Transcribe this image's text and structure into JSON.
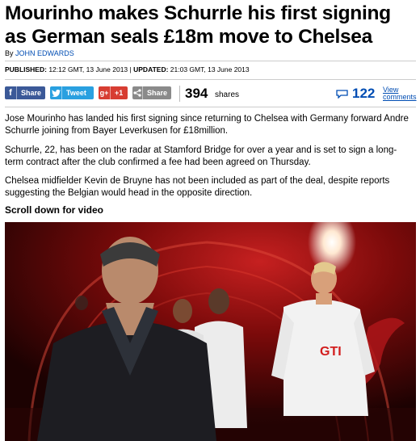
{
  "article": {
    "headline": "Mourinho makes Schurrle his first signing as German seals £18m move to Chelsea",
    "byline_prefix": "By",
    "author": "JOHN EDWARDS",
    "published_label": "PUBLISHED:",
    "published_value": "12:12 GMT, 13 June 2013",
    "separator": "|",
    "updated_label": "UPDATED:",
    "updated_value": "21:03 GMT, 13 June 2013",
    "paragraphs": [
      "Jose Mourinho has landed his first signing since returning to Chelsea with Germany forward Andre Schurrle joining from Bayer Leverkusen for £18million.",
      "Schurrle, 22, has been on the radar at Stamford Bridge for over a year and is set to sign a long-term contract after the club confirmed a fee had been agreed on Thursday.",
      "Chelsea midfielder Kevin de Bruyne has not been included as part of the deal, despite reports suggesting the Belgian would head in the opposite direction."
    ],
    "video_heading": "Scroll down for video",
    "shirt_sponsor": "GTI"
  },
  "share_bar": {
    "facebook": {
      "icon": "f",
      "label": "Share"
    },
    "twitter": {
      "icon": "t",
      "label": "Tweet"
    },
    "googleplus": {
      "icon": "g+",
      "label": "+1"
    },
    "generic": {
      "icon": "share",
      "label": "Share"
    },
    "share_count": "394",
    "shares_word": "shares",
    "comment_count": "122",
    "view_label_1": "View",
    "view_label_2": "comments"
  },
  "colors": {
    "facebook": "#3b5998",
    "twitter": "#29a0e0",
    "googleplus": "#d73d32",
    "generic": "#8a8a8a",
    "link": "#004db3"
  }
}
